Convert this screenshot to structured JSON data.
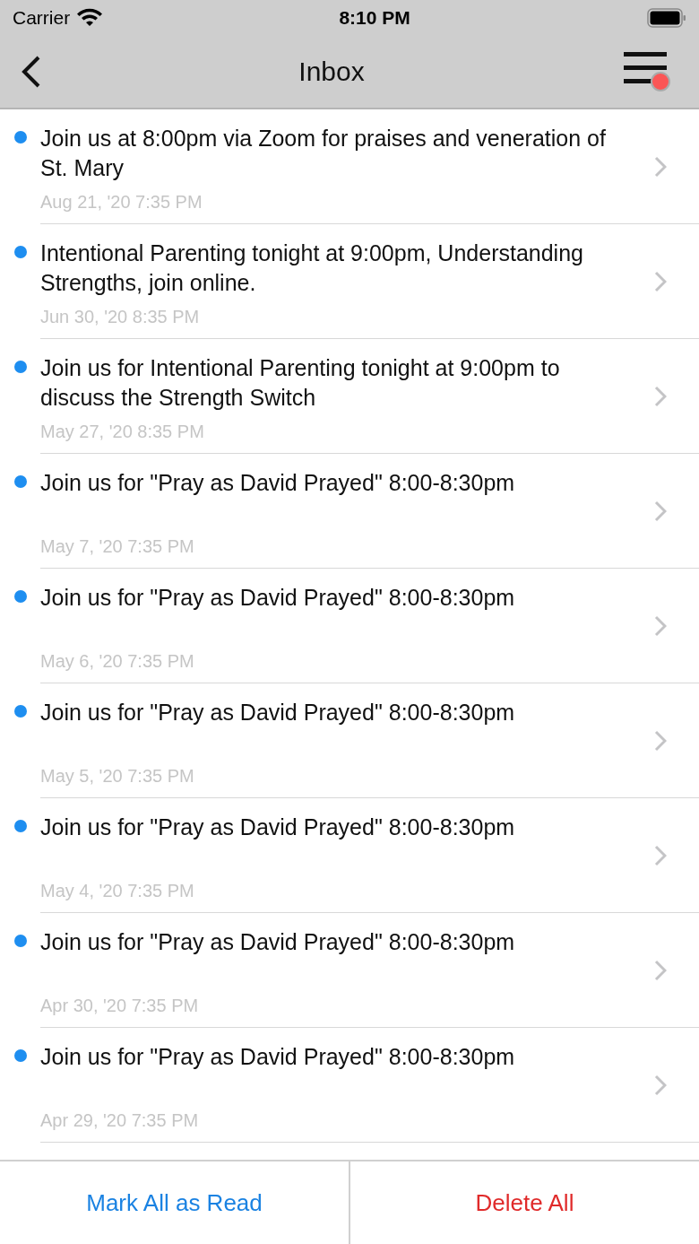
{
  "status_bar": {
    "carrier": "Carrier",
    "time": "8:10 PM"
  },
  "nav": {
    "title": "Inbox",
    "menu_badge": true
  },
  "messages": [
    {
      "title": "Join us at 8:00pm via Zoom for praises and veneration of St. Mary",
      "date": "Aug 21, '20 7:35 PM",
      "unread": true
    },
    {
      "title": "Intentional Parenting tonight at 9:00pm, Understanding Strengths, join online.",
      "date": "Jun 30, '20 8:35 PM",
      "unread": true
    },
    {
      "title": "Join us for Intentional Parenting tonight at 9:00pm to discuss the Strength Switch",
      "date": "May 27, '20 8:35 PM",
      "unread": true
    },
    {
      "title": "Join us for \"Pray as David Prayed\" 8:00-8:30pm",
      "date": "May 7, '20 7:35 PM",
      "unread": true
    },
    {
      "title": "Join us for \"Pray as David Prayed\" 8:00-8:30pm",
      "date": "May 6, '20 7:35 PM",
      "unread": true
    },
    {
      "title": "Join us for \"Pray as David Prayed\" 8:00-8:30pm",
      "date": "May 5, '20 7:35 PM",
      "unread": true
    },
    {
      "title": "Join us for \"Pray as David Prayed\" 8:00-8:30pm",
      "date": "May 4, '20 7:35 PM",
      "unread": true
    },
    {
      "title": "Join us for \"Pray as David Prayed\" 8:00-8:30pm",
      "date": "Apr 30, '20 7:35 PM",
      "unread": true
    },
    {
      "title": "Join us for \"Pray as David Prayed\" 8:00-8:30pm",
      "date": "Apr 29, '20 7:35 PM",
      "unread": true
    }
  ],
  "footer": {
    "mark_all": "Mark All as Read",
    "delete_all": "Delete All"
  }
}
